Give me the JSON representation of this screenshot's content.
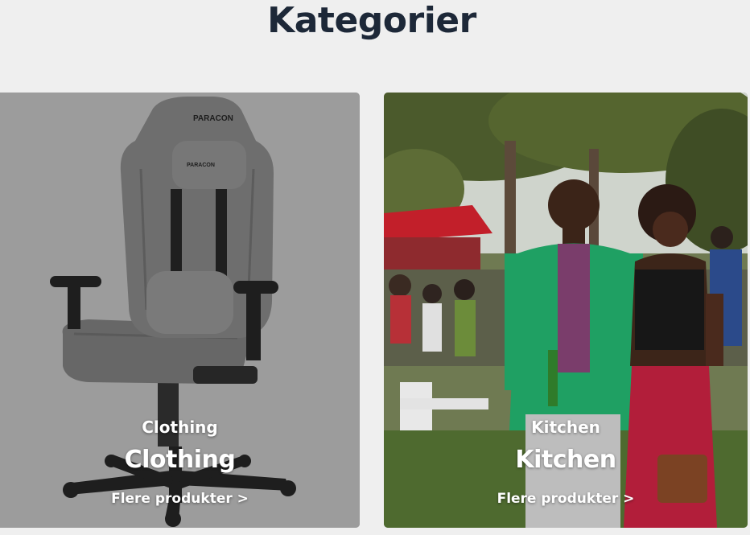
{
  "section": {
    "title": "Kategorier"
  },
  "categories": [
    {
      "label_small": "Clothing",
      "label_big": "Clothing",
      "link": "Flere produkter >",
      "brand_mark": "PARACON",
      "image": "gaming-chair-photo"
    },
    {
      "label_small": "Kitchen",
      "label_big": "Kitchen",
      "link": "Flere produkter >",
      "image": "outdoor-festival-people-photo"
    }
  ],
  "colors": {
    "page_background": "#efefef",
    "title_color": "#1d2838",
    "overlay_text": "#ffffff"
  }
}
